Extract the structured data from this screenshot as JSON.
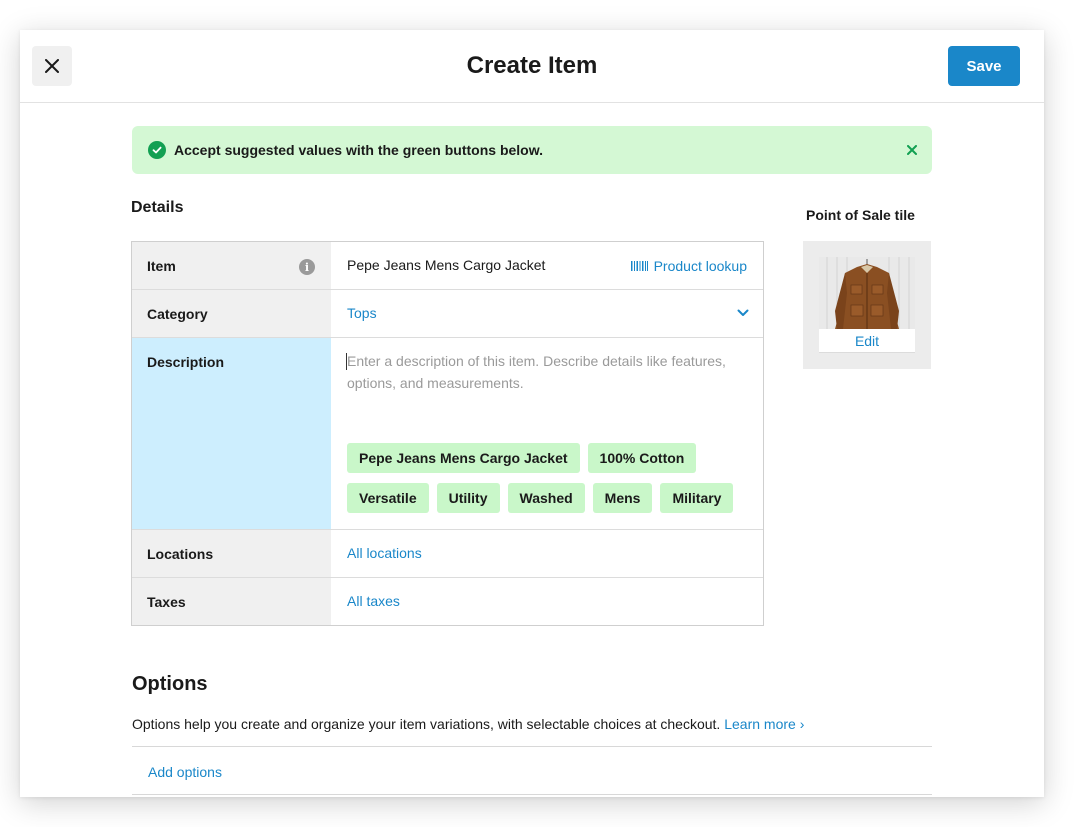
{
  "header": {
    "title": "Create Item",
    "save_label": "Save",
    "close_icon": "close-icon"
  },
  "banner": {
    "text": "Accept suggested values with the green buttons below.",
    "icon": "check-circle-icon",
    "close_icon": "close-icon",
    "color": "#d4f8d4"
  },
  "details": {
    "title": "Details",
    "item": {
      "label": "Item",
      "value": "Pepe Jeans Mens Cargo Jacket",
      "lookup_label": "Product lookup",
      "lookup_icon": "barcode-icon",
      "info_icon": "info-icon"
    },
    "category": {
      "label": "Category",
      "value": "Tops"
    },
    "description": {
      "label": "Description",
      "placeholder": "Enter a description of this item. Describe details like features, options, and measurements.",
      "suggestions": [
        "Pepe Jeans Mens Cargo Jacket",
        "100% Cotton",
        "Versatile",
        "Utility",
        "Washed",
        "Mens",
        "Military"
      ]
    },
    "locations": {
      "label": "Locations",
      "value": "All locations"
    },
    "taxes": {
      "label": "Taxes",
      "value": "All taxes"
    }
  },
  "pos_tile": {
    "title": "Point of Sale tile",
    "edit_label": "Edit"
  },
  "options": {
    "title": "Options",
    "description": "Options help you create and organize your item variations, with selectable choices at checkout.",
    "learn_more": "Learn more ›",
    "add_label": "Add options"
  },
  "colors": {
    "accent": "#1a87c9",
    "suggestion_green": "#c9f7c9",
    "active_row": "#cdeefe"
  }
}
